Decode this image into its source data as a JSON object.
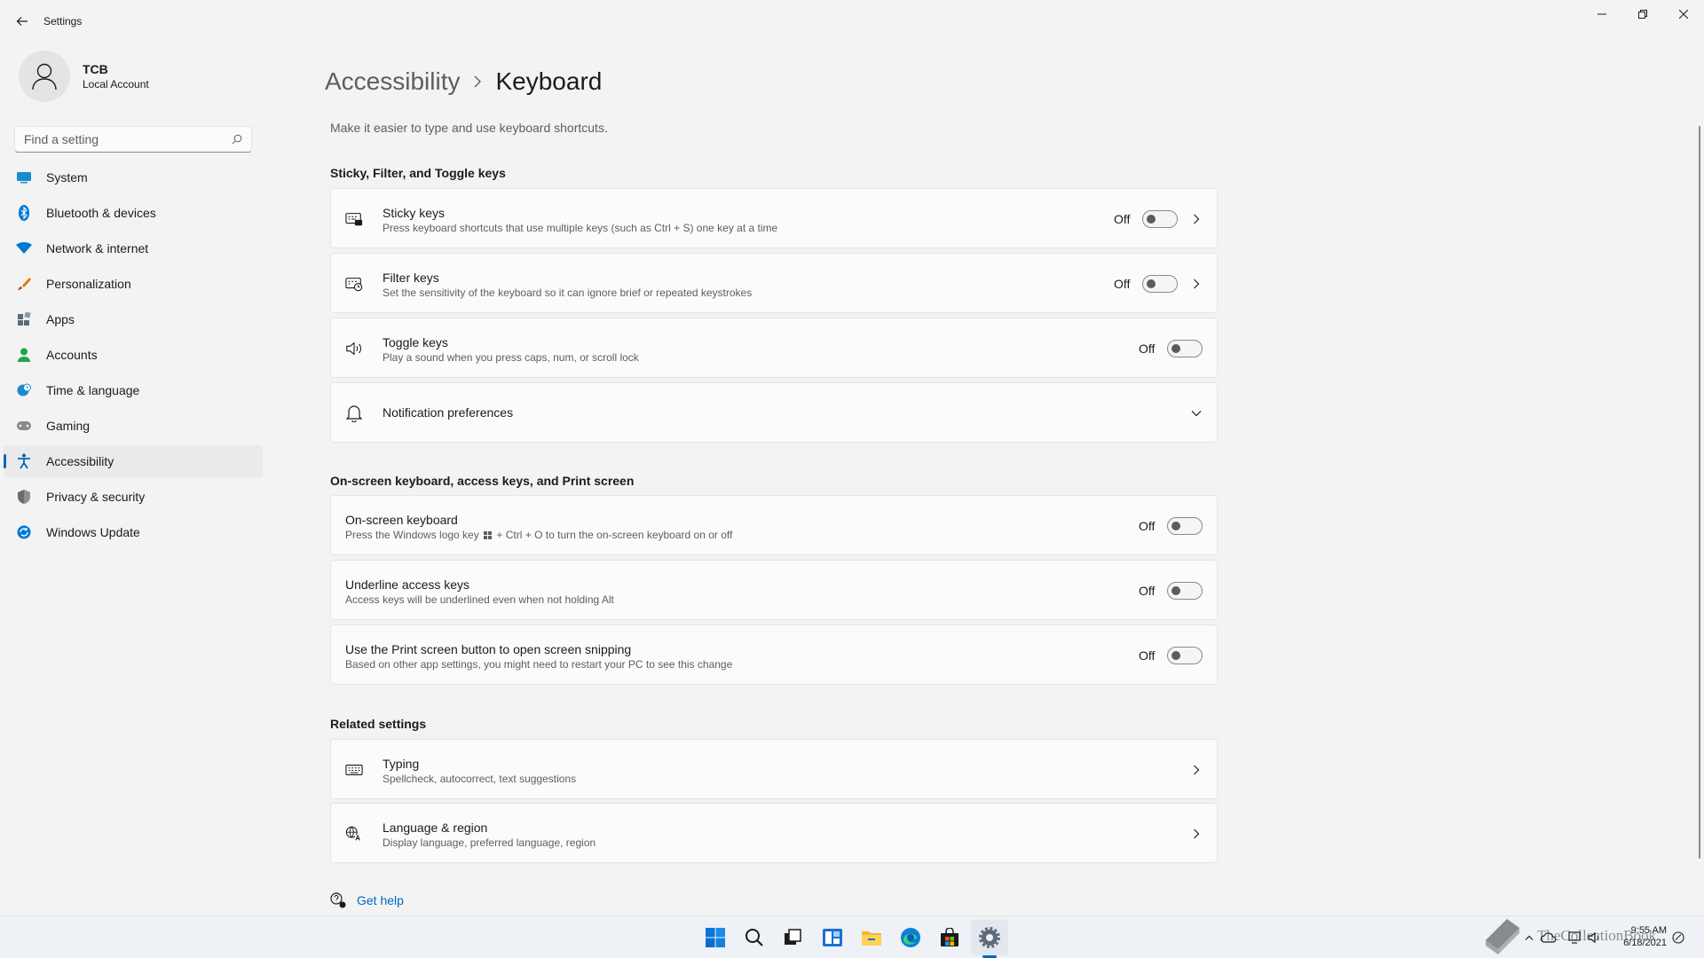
{
  "window": {
    "title": "Settings",
    "controls": [
      "minimize-icon",
      "maximize-icon",
      "close-icon"
    ]
  },
  "profile": {
    "name": "TCB",
    "account_type": "Local Account"
  },
  "search": {
    "placeholder": "Find a setting"
  },
  "sidebar": {
    "items": [
      {
        "label": "System",
        "icon": "system-icon",
        "color": "#0078d4"
      },
      {
        "label": "Bluetooth & devices",
        "icon": "bluetooth-icon",
        "color": "#0078d4"
      },
      {
        "label": "Network & internet",
        "icon": "wifi-icon",
        "color": "#0078d4"
      },
      {
        "label": "Personalization",
        "icon": "brush-icon",
        "color": "#e8740c"
      },
      {
        "label": "Apps",
        "icon": "apps-icon",
        "color": "#5b6b7e"
      },
      {
        "label": "Accounts",
        "icon": "person-icon",
        "color": "#1fa64a"
      },
      {
        "label": "Time & language",
        "icon": "globe-clock-icon",
        "color": "#1b8bd0"
      },
      {
        "label": "Gaming",
        "icon": "gamepad-icon",
        "color": "#7a7a7a"
      },
      {
        "label": "Accessibility",
        "icon": "accessibility-icon",
        "color": "#0067c0",
        "active": true
      },
      {
        "label": "Privacy & security",
        "icon": "shield-icon",
        "color": "#6b6b6b"
      },
      {
        "label": "Windows Update",
        "icon": "update-icon",
        "color": "#0078d4"
      }
    ]
  },
  "breadcrumb": {
    "parent": "Accessibility",
    "current": "Keyboard"
  },
  "description": "Make it easier to type and use keyboard shortcuts.",
  "sections": {
    "sticky": {
      "title": "Sticky, Filter, and Toggle keys",
      "cards": [
        {
          "title": "Sticky keys",
          "desc": "Press keyboard shortcuts that use multiple keys (such as Ctrl + S) one key at a time",
          "state": "Off",
          "on": false
        },
        {
          "title": "Filter keys",
          "desc": "Set the sensitivity of the keyboard so it can ignore brief or repeated keystrokes",
          "state": "Off",
          "on": false
        },
        {
          "title": "Toggle keys",
          "desc": "Play a sound when you press caps, num, or scroll lock",
          "state": "Off",
          "on": false
        },
        {
          "title": "Notification preferences"
        }
      ]
    },
    "onscreen": {
      "title": "On-screen keyboard, access keys, and Print screen",
      "cards": [
        {
          "title": "On-screen keyboard",
          "desc_pre": "Press the Windows logo key",
          "desc_post": "+ Ctrl + O to turn the on-screen keyboard on or off",
          "state": "Off",
          "on": false
        },
        {
          "title": "Underline access keys",
          "desc": "Access keys will be underlined even when not holding Alt",
          "state": "Off",
          "on": false
        },
        {
          "title": "Use the Print screen button to open screen snipping",
          "desc": "Based on other app settings, you might need to restart your PC to see this change",
          "state": "Off",
          "on": false
        }
      ]
    },
    "related": {
      "title": "Related settings",
      "cards": [
        {
          "title": "Typing",
          "desc": "Spellcheck, autocorrect, text suggestions"
        },
        {
          "title": "Language & region",
          "desc": "Display language, preferred language, region"
        }
      ]
    }
  },
  "get_help": "Get help",
  "taskbar": {
    "apps": [
      "start-icon",
      "search-icon",
      "task-view-icon",
      "widgets-icon",
      "file-explorer-icon",
      "edge-icon",
      "store-icon",
      "settings-icon"
    ],
    "time": "9:55 AM",
    "date": "6/18/2021"
  },
  "watermark": "TheCollectionBook"
}
